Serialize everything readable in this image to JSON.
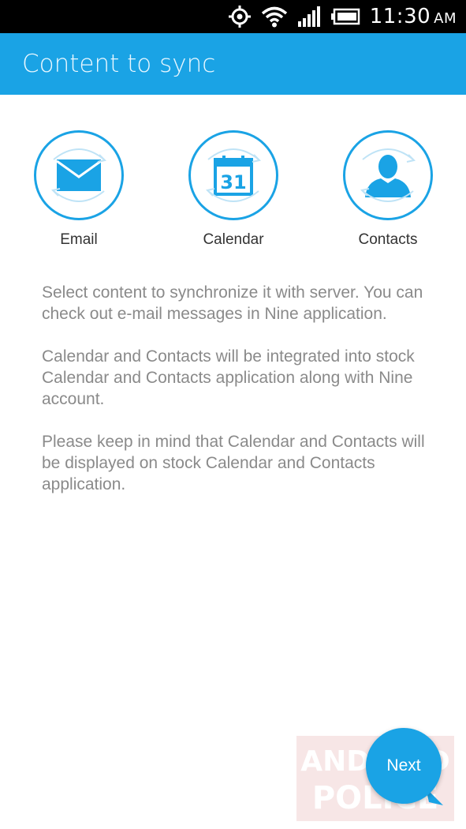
{
  "status_bar": {
    "time": "11:30",
    "ampm": "AM",
    "icons": [
      "gps-icon",
      "wifi-icon",
      "signal-icon",
      "battery-icon"
    ]
  },
  "app_bar": {
    "title": "Content to sync"
  },
  "sync_items": [
    {
      "label": "Email",
      "icon": "email-icon"
    },
    {
      "label": "Calendar",
      "icon": "calendar-icon",
      "day": "31"
    },
    {
      "label": "Contacts",
      "icon": "contacts-icon"
    }
  ],
  "description": [
    "Select content to synchronize it with server. You can check out e-mail messages in Nine application.",
    "Calendar and Contacts will be integrated into stock Calendar and Contacts application along with Nine account.",
    "Please keep in mind that Calendar and Contacts will be displayed on stock Calendar and Contacts application."
  ],
  "next_button": {
    "label": "Next"
  },
  "watermark": {
    "lines": [
      "ANDROID",
      "POLICE"
    ]
  },
  "colors": {
    "accent": "#1AA3E5",
    "text": "#8a8a8a"
  }
}
